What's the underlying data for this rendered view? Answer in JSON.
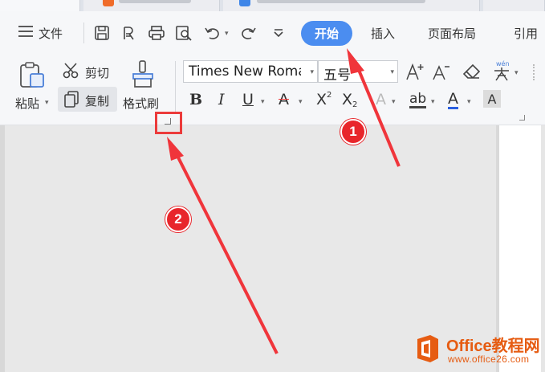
{
  "menu": {
    "file_label": "文件"
  },
  "ribbon_tabs": [
    {
      "label": "开始",
      "active": true
    },
    {
      "label": "插入"
    },
    {
      "label": "页面布局"
    },
    {
      "label": "引用"
    }
  ],
  "clipboard": {
    "paste_label": "粘贴",
    "cut_label": "剪切",
    "copy_label": "复制",
    "format_painter_label": "格式刷"
  },
  "font": {
    "family_value": "Times New Roma",
    "size_value": "五号"
  },
  "annotations": {
    "badge_1": "1",
    "badge_2": "2",
    "highlight_color": "#ec3b3b",
    "arrow_color": "#f0353b"
  },
  "watermark": {
    "title": "Office教程网",
    "url": "www.office26.com",
    "logo_color": "#e65c12"
  },
  "colors": {
    "accent": "#4b8df0",
    "ribbon_bg": "#f6f7f9",
    "doc_bg": "#e8e8e8"
  },
  "icons": [
    "menu-icon",
    "save-icon",
    "export-pdf-icon",
    "print-icon",
    "print-preview-icon",
    "undo-icon",
    "redo-icon",
    "customize-icon",
    "paste-icon",
    "scissors-icon",
    "copy-icon",
    "format-painter-icon",
    "grow-font-icon",
    "shrink-font-icon",
    "clear-format-icon",
    "phonetic-guide-icon",
    "bold-icon",
    "italic-icon",
    "underline-icon",
    "strikethrough-icon",
    "superscript-icon",
    "subscript-icon",
    "text-effect-icon",
    "highlight-icon",
    "font-color-icon",
    "char-shading-icon",
    "dialog-launcher-icon"
  ]
}
